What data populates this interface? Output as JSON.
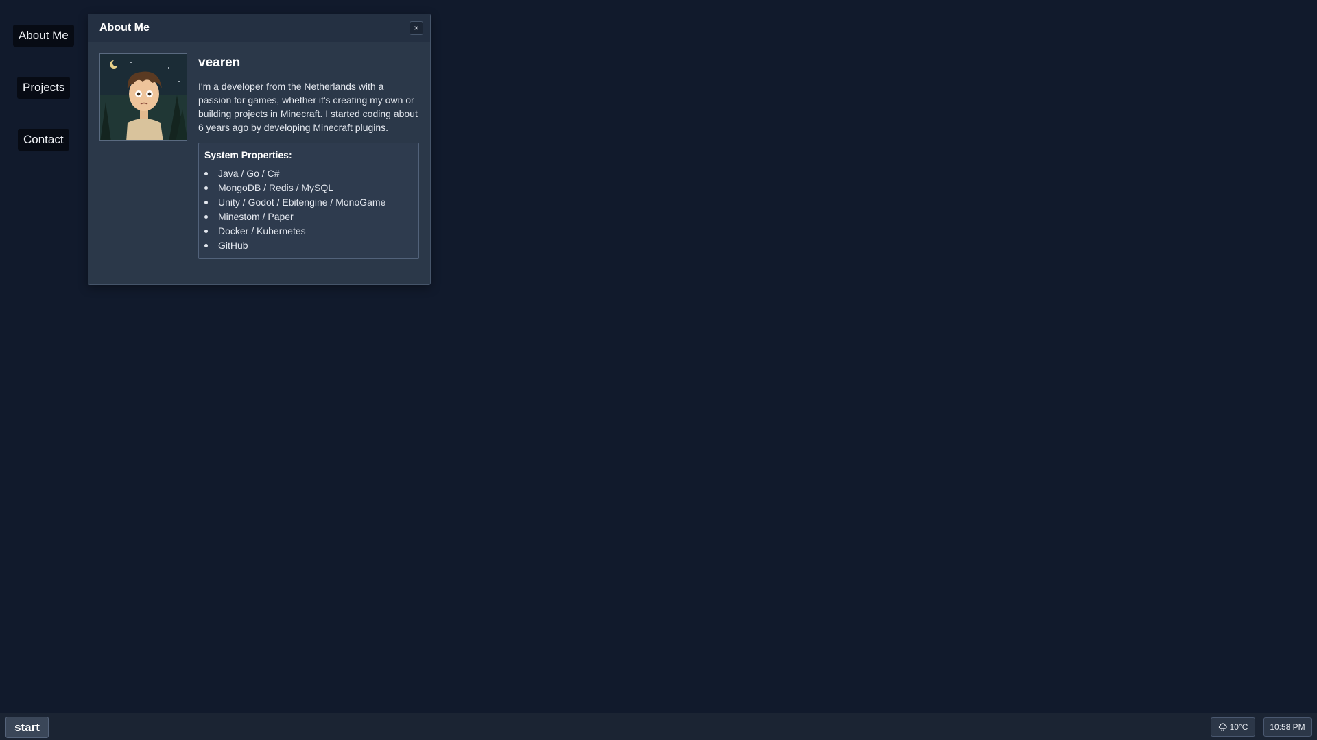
{
  "desktop": {
    "shortcuts": [
      {
        "label": "About Me"
      },
      {
        "label": "Projects"
      },
      {
        "label": "Contact"
      }
    ]
  },
  "window": {
    "title": "About Me",
    "close_label": "×",
    "avatar_icon": "avatar-portrait-icon",
    "username": "vearen",
    "bio": "I'm a developer from the Netherlands with a passion for games, whether it's creating my own or building projects in Minecraft. I started coding about 6 years ago by developing Minecraft plugins.",
    "properties": {
      "title": "System Properties:",
      "items": [
        "Java / Go / C#",
        "MongoDB / Redis / MySQL",
        "Unity / Godot / Ebitengine / MonoGame",
        "Minestom / Paper",
        "Docker / Kubernetes",
        "GitHub"
      ]
    }
  },
  "taskbar": {
    "start_label": "start",
    "weather": {
      "icon": "cloud-rain-icon",
      "temperature": "10°C"
    },
    "clock": "10:58 PM"
  },
  "colors": {
    "desktop_bg": "#111a2c",
    "window_bg": "#2b3849",
    "taskbar_bg": "#1b2433"
  }
}
